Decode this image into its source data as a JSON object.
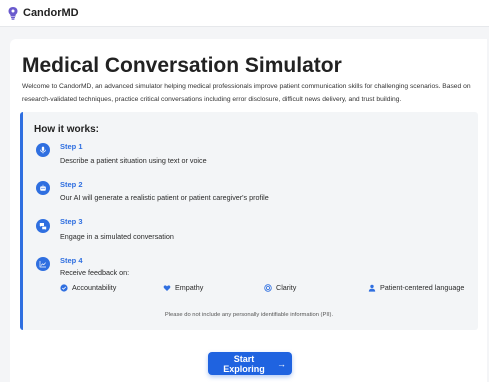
{
  "header": {
    "brand": "CandorMD"
  },
  "page": {
    "title": "Medical Conversation Simulator",
    "intro": "Welcome to CandorMD, an advanced simulator helping medical professionals improve patient communication skills for challenging scenarios. Based on research-validated techniques, practice critical conversations including error disclosure, difficult news delivery, and trust building."
  },
  "how": {
    "title": "How it works:",
    "steps": [
      {
        "label": "Step 1",
        "desc": "Describe a patient situation using text or voice",
        "icon": "microphone-icon"
      },
      {
        "label": "Step 2",
        "desc": "Our AI will generate a realistic patient or patient caregiver's profile",
        "icon": "robot-icon"
      },
      {
        "label": "Step 3",
        "desc": "Engage in a simulated conversation",
        "icon": "chat-bubbles-icon"
      },
      {
        "label": "Step 4",
        "desc": "Receive feedback on:",
        "icon": "chart-icon"
      }
    ],
    "feedback": [
      "Accountability",
      "Empathy",
      "Clarity",
      "Patient-centered language"
    ],
    "note": "Please do not include any personally identifiable information (PII)."
  },
  "cta": {
    "label": "Start Exploring",
    "arrow": "→"
  },
  "colors": {
    "accent": "#2f6fe0",
    "button": "#1f63e0",
    "box": "#f3f5f7"
  }
}
